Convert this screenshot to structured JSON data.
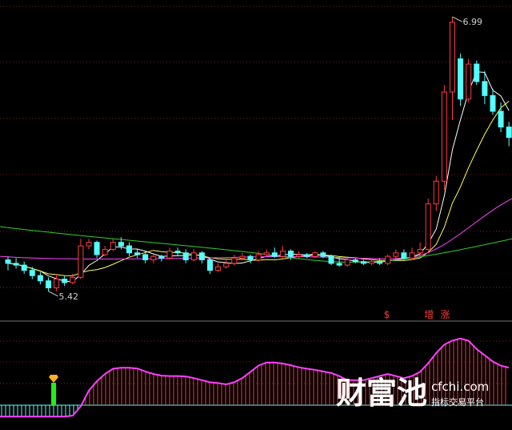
{
  "chart_data": {
    "type": "candlestick",
    "y_range": [
      5.3,
      7.05
    ],
    "annotations": {
      "high_label": "6.99",
      "low_label": "5.42"
    },
    "signals": [
      {
        "text": "$",
        "index": 47
      },
      {
        "text": "增",
        "index": 52
      },
      {
        "text": "涨",
        "index": 54
      }
    ],
    "candles": [
      [
        5.6,
        5.58,
        5.62,
        5.54
      ],
      [
        5.58,
        5.57,
        5.61,
        5.55
      ],
      [
        5.57,
        5.54,
        5.59,
        5.52
      ],
      [
        5.54,
        5.51,
        5.56,
        5.49
      ],
      [
        5.51,
        5.48,
        5.53,
        5.46
      ],
      [
        5.48,
        5.44,
        5.5,
        5.42
      ],
      [
        5.44,
        5.49,
        5.52,
        5.42
      ],
      [
        5.49,
        5.47,
        5.51,
        5.45
      ],
      [
        5.47,
        5.5,
        5.52,
        5.46
      ],
      [
        5.5,
        5.68,
        5.72,
        5.49
      ],
      [
        5.68,
        5.7,
        5.72,
        5.66
      ],
      [
        5.7,
        5.63,
        5.71,
        5.61
      ],
      [
        5.63,
        5.66,
        5.68,
        5.62
      ],
      [
        5.66,
        5.7,
        5.72,
        5.65
      ],
      [
        5.7,
        5.68,
        5.73,
        5.66
      ],
      [
        5.68,
        5.64,
        5.7,
        5.62
      ],
      [
        5.64,
        5.63,
        5.66,
        5.61
      ],
      [
        5.63,
        5.6,
        5.65,
        5.58
      ],
      [
        5.6,
        5.62,
        5.64,
        5.58
      ],
      [
        5.62,
        5.61,
        5.63,
        5.59
      ],
      [
        5.61,
        5.65,
        5.67,
        5.6
      ],
      [
        5.65,
        5.64,
        5.67,
        5.62
      ],
      [
        5.64,
        5.6,
        5.66,
        5.58
      ],
      [
        5.6,
        5.64,
        5.66,
        5.59
      ],
      [
        5.64,
        5.6,
        5.65,
        5.58
      ],
      [
        5.6,
        5.54,
        5.61,
        5.52
      ],
      [
        5.54,
        5.56,
        5.58,
        5.53
      ],
      [
        5.56,
        5.58,
        5.6,
        5.55
      ],
      [
        5.58,
        5.61,
        5.63,
        5.57
      ],
      [
        5.61,
        5.62,
        5.64,
        5.6
      ],
      [
        5.62,
        5.6,
        5.63,
        5.58
      ],
      [
        5.6,
        5.63,
        5.65,
        5.59
      ],
      [
        5.63,
        5.64,
        5.66,
        5.62
      ],
      [
        5.64,
        5.62,
        5.67,
        5.61
      ],
      [
        5.62,
        5.65,
        5.68,
        5.61
      ],
      [
        5.65,
        5.62,
        5.66,
        5.6
      ],
      [
        5.62,
        5.63,
        5.65,
        5.61
      ],
      [
        5.63,
        5.62,
        5.64,
        5.61
      ],
      [
        5.62,
        5.64,
        5.65,
        5.61
      ],
      [
        5.64,
        5.62,
        5.65,
        5.61
      ],
      [
        5.62,
        5.58,
        5.63,
        5.57
      ],
      [
        5.58,
        5.57,
        5.62,
        5.56
      ],
      [
        5.57,
        5.6,
        5.61,
        5.56
      ],
      [
        5.6,
        5.59,
        5.61,
        5.58
      ],
      [
        5.59,
        5.58,
        5.6,
        5.57
      ],
      [
        5.58,
        5.59,
        5.61,
        5.57
      ],
      [
        5.59,
        5.58,
        5.61,
        5.57
      ],
      [
        5.58,
        5.62,
        5.63,
        5.57
      ],
      [
        5.62,
        5.64,
        5.66,
        5.61
      ],
      [
        5.64,
        5.61,
        5.66,
        5.6
      ],
      [
        5.61,
        5.64,
        5.67,
        5.6
      ],
      [
        5.64,
        5.66,
        5.7,
        5.62
      ],
      [
        5.66,
        5.92,
        5.95,
        5.65
      ],
      [
        5.92,
        6.05,
        6.08,
        5.88
      ],
      [
        6.05,
        6.56,
        6.6,
        6.0
      ],
      [
        6.56,
        6.96,
        6.99,
        6.4
      ],
      [
        6.75,
        6.52,
        6.78,
        6.48
      ],
      [
        6.52,
        6.72,
        6.75,
        6.5
      ],
      [
        6.72,
        6.62,
        6.74,
        6.6
      ],
      [
        6.62,
        6.54,
        6.68,
        6.49
      ],
      [
        6.54,
        6.45,
        6.58,
        6.43
      ],
      [
        6.45,
        6.36,
        6.5,
        6.33
      ],
      [
        6.36,
        6.3,
        6.39,
        6.25
      ]
    ],
    "indicator": {
      "type": "oscillator",
      "values": [
        -0.55,
        -0.55,
        -0.55,
        -0.55,
        -0.55,
        -0.55,
        -0.55,
        -0.55,
        -0.55,
        -0.5,
        -0.05,
        0.7,
        1.15,
        1.5,
        1.75,
        1.8,
        1.8,
        1.76,
        1.62,
        1.5,
        1.42,
        1.4,
        1.4,
        1.38,
        1.3,
        1.2,
        1.1,
        1.06,
        1.0,
        1.1,
        1.3,
        1.6,
        1.9,
        2.05,
        2.05,
        2.0,
        1.92,
        1.82,
        1.75,
        1.7,
        1.62,
        1.55,
        1.4,
        1.2,
        1.2,
        1.2,
        1.3,
        1.4,
        1.5,
        1.4,
        1.3,
        1.4,
        1.6,
        2.0,
        2.5,
        2.9,
        3.1,
        3.2,
        3.1,
        2.7,
        2.4,
        2.1,
        1.9,
        1.8
      ],
      "signal_index": 11
    }
  },
  "watermark": {
    "logo": "财富池",
    "url": "cfchi.com",
    "tagline": "指标交易平台"
  },
  "colors": {
    "background": "#000000",
    "up": "#ff3b3b",
    "down": "#54ffff",
    "ma_short": "#ffffff",
    "ma_mid": "#ffff50",
    "ma_long": "#ff40ff",
    "ma_xlong": "#30d030",
    "grid": "#8a1a1a",
    "osc_line": "#ff40ff",
    "osc_pos": "#ff3b3b",
    "osc_neg": "#54ffff",
    "signal_bar": "#22ee22",
    "gem": "#ffb020"
  }
}
